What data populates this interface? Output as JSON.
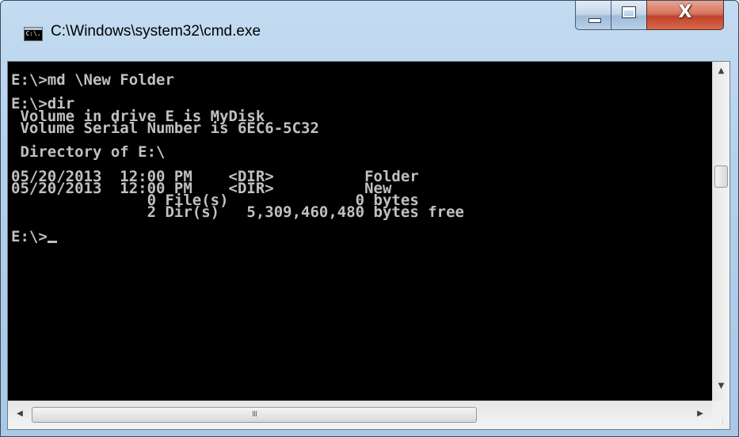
{
  "window": {
    "title": "C:\\Windows\\system32\\cmd.exe",
    "icon_text": "C:\\."
  },
  "caption": {
    "close_glyph": "X"
  },
  "console": {
    "text": "E:\\>md \\New Folder\n\nE:\\>dir\n Volume in drive E is MyDisk\n Volume Serial Number is 6EC6-5C32\n\n Directory of E:\\\n\n05/20/2013  12:00 PM    <DIR>          Folder\n05/20/2013  12:00 PM    <DIR>          New\n               0 File(s)              0 bytes\n               2 Dir(s)   5,309,460,480 bytes free\n\nE:\\>",
    "prompt_suffix": "",
    "text_color": "#c0c0c0",
    "background_color": "#000000"
  },
  "scrollbars": {
    "grip_glyph": "III"
  }
}
